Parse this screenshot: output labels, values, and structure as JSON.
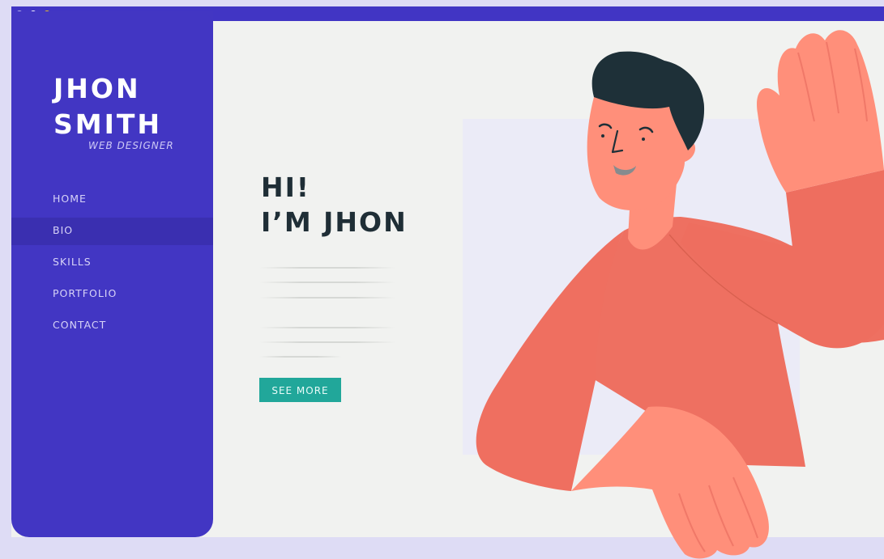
{
  "window": {
    "dots": [
      "#b9b4ec",
      "#ffffff",
      "#f5c518"
    ]
  },
  "sidebar": {
    "name_line1": "JHON",
    "name_line2": "SMITH",
    "role": "WEB DESIGNER",
    "items": [
      {
        "label": "HOME",
        "active": false
      },
      {
        "label": "BIO",
        "active": true
      },
      {
        "label": "SKILLS",
        "active": false
      },
      {
        "label": "PORTFOLIO",
        "active": false
      },
      {
        "label": "CONTACT",
        "active": false
      }
    ]
  },
  "hero": {
    "greeting": "HI!",
    "headline": "I’M JHON",
    "button_label": "SEE MORE"
  },
  "colors": {
    "accent": "#4236c3",
    "button": "#21a79a",
    "sweater": "#ee7061",
    "skin": "#ff8f7a",
    "hair": "#1e3038",
    "heading": "#1f2e36"
  },
  "illustration": {
    "subject": "waving-man-illustration"
  }
}
